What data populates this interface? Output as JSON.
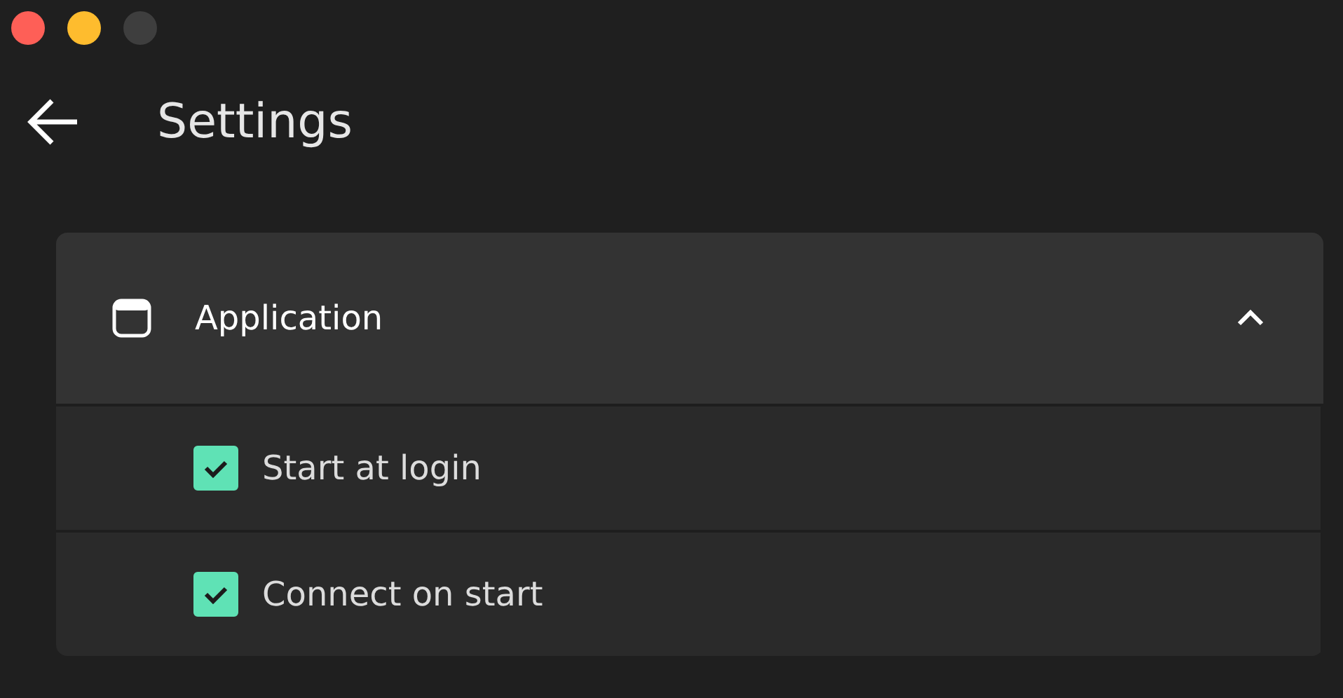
{
  "page": {
    "title": "Settings"
  },
  "section": {
    "title": "Application",
    "expanded": true,
    "options": [
      {
        "label": "Start at login",
        "checked": true
      },
      {
        "label": "Connect on start",
        "checked": true
      }
    ]
  }
}
